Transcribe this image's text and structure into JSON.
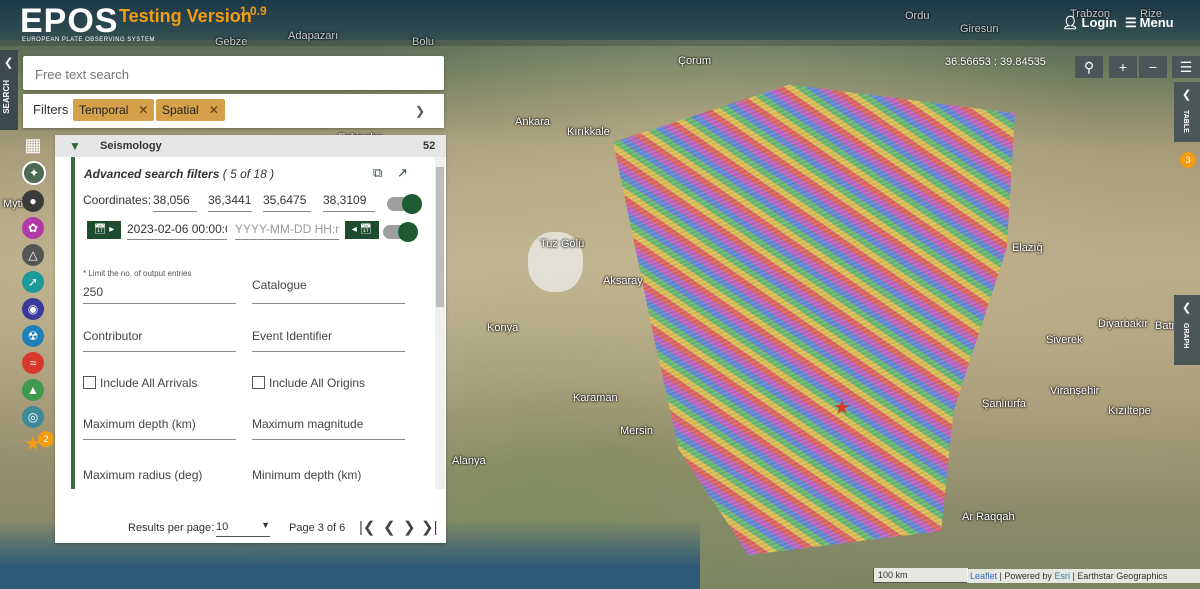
{
  "header": {
    "logo": "EPOS",
    "logo_sub": "EUROPEAN PLATE OBSERVING SYSTEM",
    "testing_label": "Testing Version",
    "version": "1.0.9",
    "login_label": "Login",
    "menu_label": "Menu"
  },
  "sidebar_tab": {
    "label": "SEARCH"
  },
  "search": {
    "placeholder": "Free text search"
  },
  "filters": {
    "label": "Filters",
    "chips": [
      "Temporal",
      "Spatial"
    ]
  },
  "category_icons": [
    "grid-icon",
    "seismology-icon",
    "satellite-icon",
    "volcano-icon",
    "geodesy-icon",
    "magnetic-icon",
    "tsunami-icon",
    "lab-icon",
    "anthropogenic-icon",
    "geology-icon",
    "multi-icon",
    "favourites-icon"
  ],
  "favourites_badge": "2",
  "results": {
    "title": "Seismology",
    "count": "52",
    "advanced_title": "Advanced search filters",
    "advanced_count": "( 5 of 18 )",
    "coordinates_label": "Coordinates:",
    "coordinates": [
      "38,056",
      "36,3441",
      "35,6475",
      "38,3109"
    ],
    "date_start": "2023-02-06 00:00:0",
    "date_end_placeholder": "YYYY-MM-DD HH:m",
    "limit_hint": "* Limit the no. of output entries",
    "limit_value": "250",
    "fields": {
      "catalogue": "Catalogue",
      "contributor": "Contributor",
      "event_identifier": "Event Identifier",
      "max_depth": "Maximum depth (km)",
      "max_magnitude": "Maximum magnitude",
      "max_radius": "Maximum radius (deg)",
      "min_depth": "Minimum depth (km)"
    },
    "checkboxes": {
      "include_arrivals": "Include All Arrivals",
      "include_origins": "Include All Origins"
    }
  },
  "pager": {
    "results_per_page_label": "Results per page:",
    "results_per_page": "10",
    "page_label": "Page 3 of 6"
  },
  "map": {
    "coordinates_readout": "36.56653 : 39.84535",
    "places": [
      "Ordu",
      "Giresun",
      "Trabzon",
      "Rize",
      "Gebze",
      "Adapazarı",
      "Bolu",
      "Çorum",
      "Eskişehir",
      "Ankara",
      "Kırıkkale",
      "Tuz Gölü",
      "Aksaray",
      "Konya",
      "Karaman",
      "Mersin",
      "Alanya",
      "Elazığ",
      "Diyarbakır",
      "Batman",
      "Siverek",
      "Şanlıurfa",
      "Viranşehir",
      "Kızıltepe",
      "Ar Raqqah",
      "Mytile"
    ],
    "side_tabs": {
      "table": "TABLE",
      "graph": "GRAPH"
    },
    "table_badge": "3",
    "scale": "100 km",
    "attribution": {
      "leaflet": "Leaflet",
      "powered": "| Powered by",
      "esri": "Esri",
      "earthstar": "| Earthstar Geographics"
    }
  },
  "colors": {
    "accent": "#f39c12",
    "brand_green": "#1e5a32",
    "chip": "#d4a04a"
  }
}
